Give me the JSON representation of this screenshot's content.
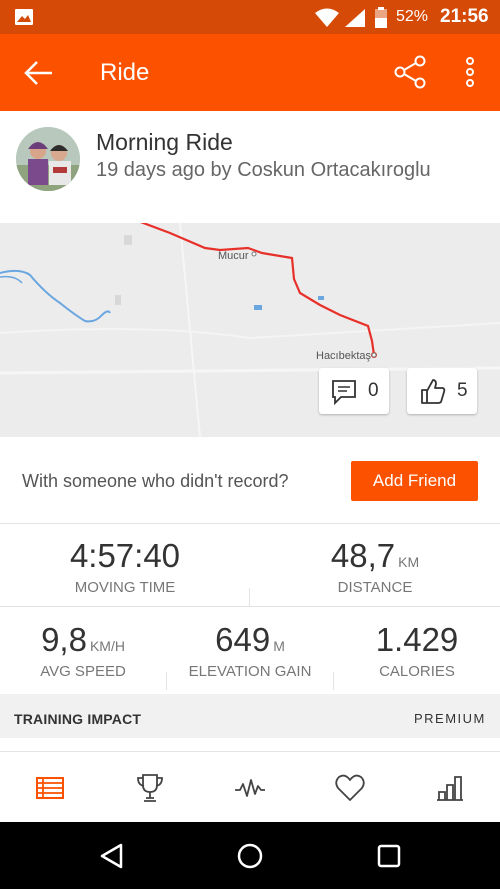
{
  "status_bar": {
    "battery": "52%",
    "time": "21:56",
    "icons": [
      "image-icon",
      "wifi-icon",
      "signal-icon",
      "battery-icon"
    ]
  },
  "app_bar": {
    "title": "Ride",
    "icons": [
      "back-arrow-icon",
      "share-icon",
      "more-icon"
    ]
  },
  "activity": {
    "title": "Morning Ride",
    "subtitle": "19 days ago by Coskun Ortacakıroglu"
  },
  "map": {
    "towns": [
      "Mucur",
      "Hacıbektaş"
    ],
    "route_color": "#e8302a",
    "comments": "0",
    "kudos": "5"
  },
  "friend_prompt": {
    "question": "With someone who didn't record?",
    "button": "Add Friend"
  },
  "stats": {
    "moving_time": {
      "value": "4:57:40",
      "label": "MOVING TIME"
    },
    "distance": {
      "value": "48,7",
      "unit": "KM",
      "label": "DISTANCE"
    },
    "avg_speed": {
      "value": "9,8",
      "unit": "KM/H",
      "label": "AVG SPEED"
    },
    "elevation": {
      "value": "649",
      "unit": "M",
      "label": "ELEVATION GAIN"
    },
    "calories": {
      "value": "1.429",
      "label": "CALORIES"
    }
  },
  "training_impact": {
    "title": "TRAINING IMPACT",
    "badge": "PREMIUM"
  },
  "bottom_nav": [
    "feed-icon",
    "trophy-icon",
    "activity-icon",
    "heart-icon",
    "stats-icon"
  ],
  "colors": {
    "brand": "#fc5200",
    "status_bar": "#d44a06"
  }
}
